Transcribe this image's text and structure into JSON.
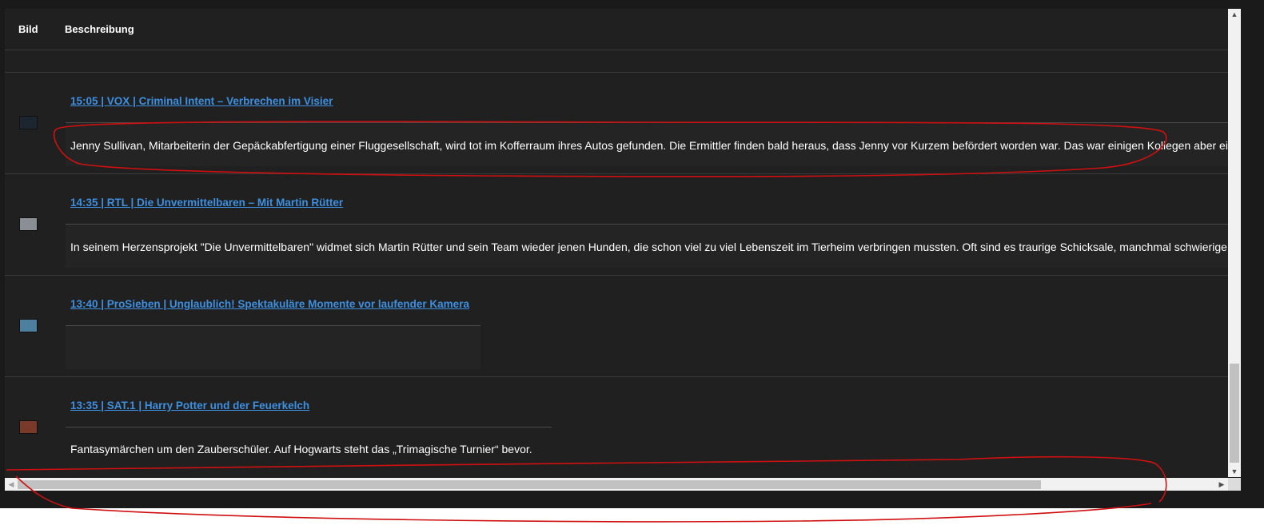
{
  "table": {
    "columns": {
      "image": "Bild",
      "description": "Beschreibung"
    },
    "rows": [
      {
        "title": "15:05 | VOX | Criminal Intent – Verbrechen im Visier",
        "description": "Jenny Sullivan, Mitarbeiterin der Gepäckabfertigung einer Fluggesellschaft, wird tot im Kofferraum ihres Autos gefunden. Die Ermittler finden bald heraus, dass Jenny vor Kurzem befördert worden war. Das war einigen Kollegen aber ein Dorn im Auge.",
        "thumb_color": "#1c2630"
      },
      {
        "title": "14:35 | RTL | Die Unvermittelbaren – Mit Martin Rütter",
        "description": "In seinem Herzensprojekt \"Die Unvermittelbaren\" widmet sich Martin Rütter und sein Team wieder jenen Hunden, die schon viel zu viel Lebenszeit im Tierheim verbringen mussten. Oft sind es traurige Schicksale, manchmal schwierige Charaktere.",
        "thumb_color": "#8a8f96"
      },
      {
        "title": "13:40 | ProSieben | Unglaublich! Spektakuläre Momente vor laufender Kamera",
        "description": "",
        "thumb_color": "#4d7f9e"
      },
      {
        "title": "13:35 | SAT.1 | Harry Potter und der Feuerkelch",
        "description": "Fantasymärchen um den Zauberschüler. Auf Hogwarts steht das „Trimagische Turnier“ bevor.",
        "thumb_color": "#7a3a2a"
      }
    ]
  },
  "scrollbars": {
    "vertical_position": 0.76,
    "horizontal_position": 0.0
  },
  "colors": {
    "background": "#202020",
    "link": "#3d8fe0",
    "text": "#ffffff",
    "annotation": "#d01010"
  }
}
